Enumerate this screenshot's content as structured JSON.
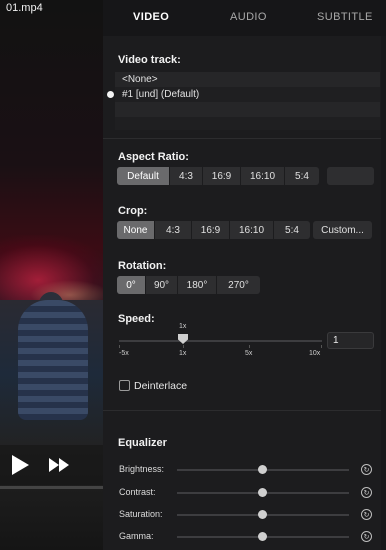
{
  "video": {
    "filename": "01.mp4"
  },
  "tabs": [
    {
      "label": "VIDEO",
      "active": true
    },
    {
      "label": "AUDIO",
      "active": false
    },
    {
      "label": "SUBTITLE",
      "active": false
    }
  ],
  "video_track": {
    "title": "Video track:",
    "options": [
      "<None>",
      "#1  [und] (Default)"
    ],
    "selected_index": 1
  },
  "aspect_ratio": {
    "title": "Aspect Ratio:",
    "options": [
      "Default",
      "4:3",
      "16:9",
      "16:10",
      "5:4"
    ],
    "selected": "Default"
  },
  "crop": {
    "title": "Crop:",
    "options": [
      "None",
      "4:3",
      "16:9",
      "16:10",
      "5:4"
    ],
    "selected": "None",
    "custom_label": "Custom..."
  },
  "rotation": {
    "title": "Rotation:",
    "options": [
      "0°",
      "90°",
      "180°",
      "270°"
    ],
    "selected": "0°"
  },
  "speed": {
    "title": "Speed:",
    "current_marker": "1x",
    "ticks": [
      "-5x",
      "1x",
      "5x",
      "10x"
    ],
    "value": "1"
  },
  "deinterlace": {
    "label": "Deinterlace",
    "checked": false
  },
  "equalizer": {
    "title": "Equalizer",
    "rows": [
      {
        "label": "Brightness:",
        "level": 0.5
      },
      {
        "label": "Contrast:",
        "level": 0.5
      },
      {
        "label": "Saturation:",
        "level": 0.5
      },
      {
        "label": "Gamma:",
        "level": 0.5
      }
    ]
  },
  "colors": {
    "panel": "#1c1c1e",
    "selected_segment": "#6a6a6c",
    "accent_text": "#ffffff"
  },
  "icons": [
    "play-icon",
    "fast-forward-icon",
    "reset-icon"
  ]
}
